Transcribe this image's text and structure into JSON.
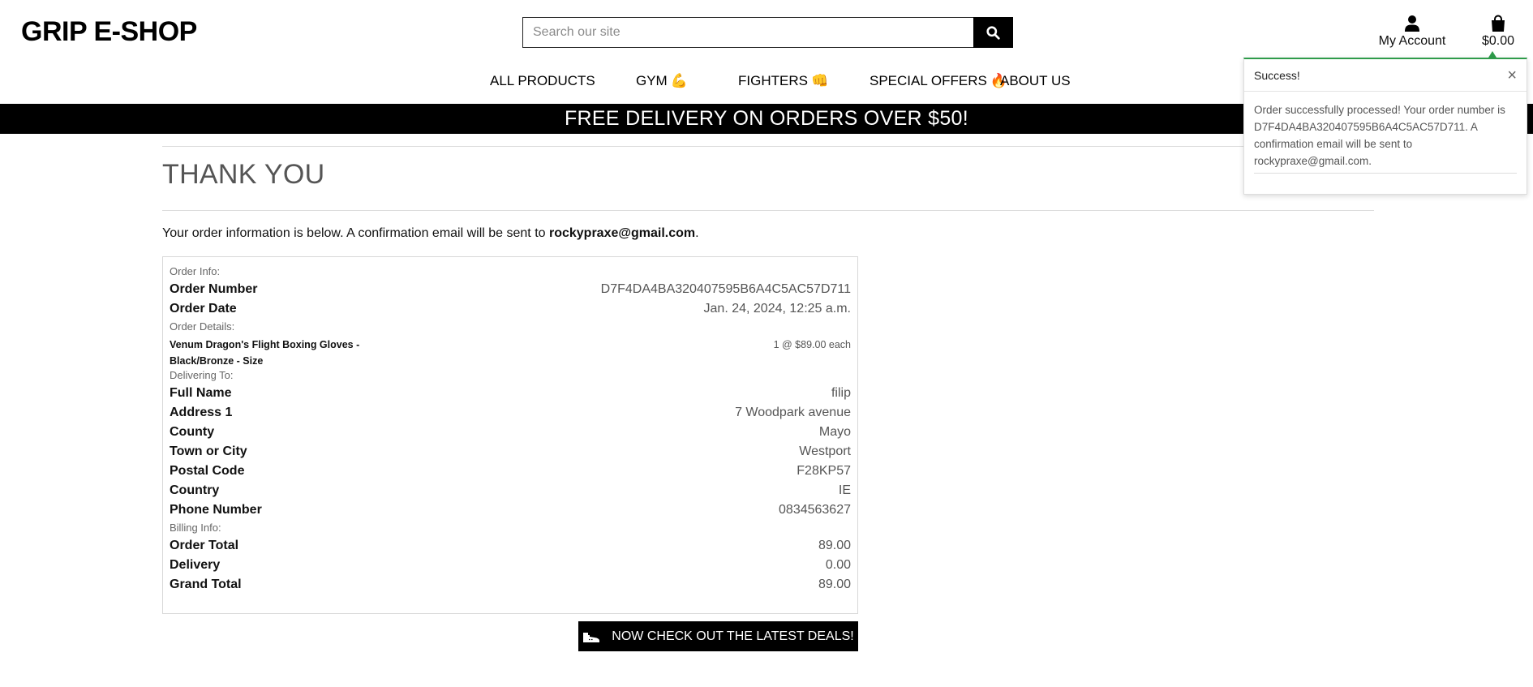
{
  "header": {
    "brand": "GRIP E-SHOP",
    "search_placeholder": "Search our site",
    "account_label": "My Account",
    "bag_total": "$0.00"
  },
  "nav": {
    "items": [
      {
        "label": "ALL PRODUCTS",
        "emoji": ""
      },
      {
        "label": "GYM",
        "emoji": "💪"
      },
      {
        "label": "FIGHTERS",
        "emoji": "👊"
      },
      {
        "label": "SPECIAL OFFERS",
        "emoji": "🔥"
      },
      {
        "label": "ABOUT US",
        "emoji": ""
      }
    ]
  },
  "banner": "FREE DELIVERY ON ORDERS OVER $50!",
  "main": {
    "title": "THANK YOU",
    "intro_text": "Your order information is below. A confirmation email will be sent to ",
    "intro_email": "rockypraxe@gmail.com",
    "intro_end": "."
  },
  "order": {
    "order_info_label": "Order Info:",
    "order_number_label": "Order Number",
    "order_number": "D7F4DA4BA320407595B6A4C5AC57D711",
    "order_date_label": "Order Date",
    "order_date": "Jan. 24, 2024, 12:25 a.m.",
    "order_details_label": "Order Details:",
    "item_name": "Venum Dragon's Flight Boxing Gloves - Black/Bronze - Size",
    "item_qty": "1 @ $89.00 each",
    "delivering_label": "Delivering To:",
    "delivery_rows": [
      {
        "label": "Full Name",
        "value": "filip"
      },
      {
        "label": "Address 1",
        "value": "7 Woodpark avenue"
      },
      {
        "label": "County",
        "value": "Mayo"
      },
      {
        "label": "Town or City",
        "value": "Westport"
      },
      {
        "label": "Postal Code",
        "value": "F28KP57"
      },
      {
        "label": "Country",
        "value": "IE"
      },
      {
        "label": "Phone Number",
        "value": "0834563627"
      }
    ],
    "billing_label": "Billing Info:",
    "billing_rows": [
      {
        "label": "Order Total",
        "value": "89.00"
      },
      {
        "label": "Delivery",
        "value": "0.00"
      },
      {
        "label": "Grand Total",
        "value": "89.00"
      }
    ]
  },
  "deals_button": "NOW CHECK OUT THE LATEST DEALS!",
  "toast": {
    "title": "Success!",
    "close": "×",
    "message": "Order successfully processed! Your order number is D7F4DA4BA320407595B6A4C5AC57D711. A confirmation email will be sent to rockypraxe@gmail.com."
  },
  "colors": {
    "brand_black": "#000000",
    "success_green": "#2e9b4a",
    "muted_text": "#555555"
  },
  "icons": [
    "search-icon",
    "user-icon",
    "shopping-bag-icon",
    "close-icon",
    "shoe-icon"
  ]
}
